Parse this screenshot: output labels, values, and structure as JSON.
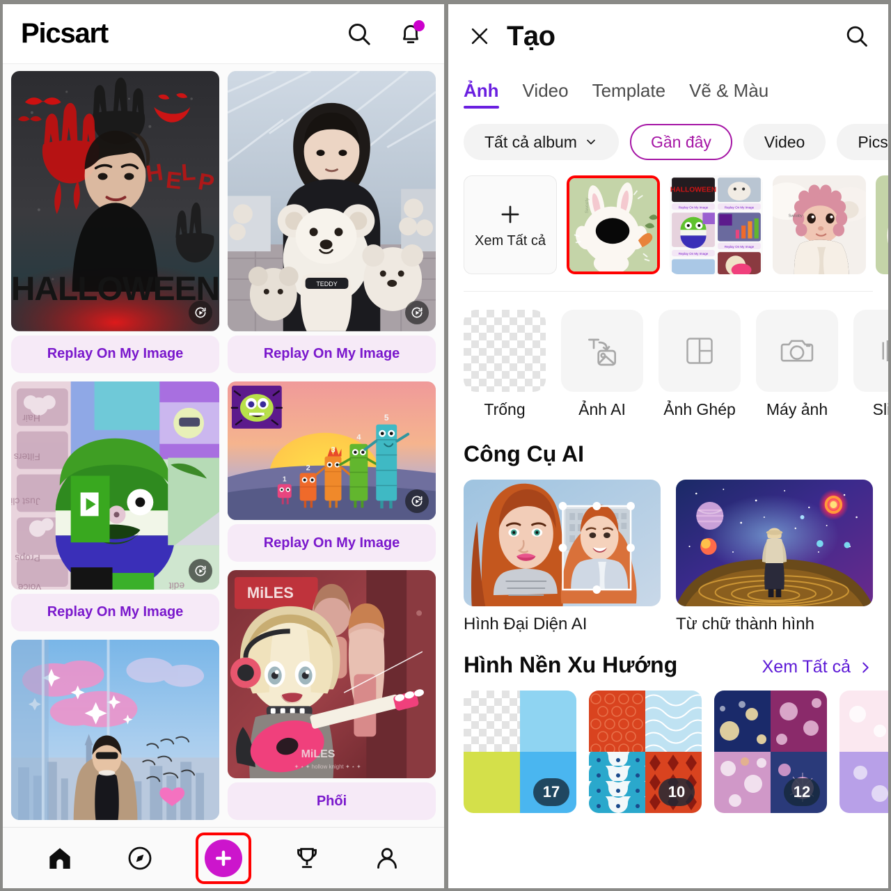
{
  "left": {
    "header": {
      "logo": "Picsart",
      "search_icon": "search-icon",
      "bell_icon": "bell-icon"
    },
    "feed": {
      "cards": [
        {
          "id": "halloween",
          "cta": "Replay On My Image",
          "has_replay_badge": true,
          "column": "left"
        },
        {
          "id": "teddy-bear",
          "cta": "Replay On My Image",
          "has_replay_badge": true,
          "column": "right"
        },
        {
          "id": "green-avatar",
          "cta": "Replay On My Image",
          "has_replay_badge": true,
          "column": "left"
        },
        {
          "id": "numberblocks",
          "cta": "Replay On My Image",
          "has_replay_badge": true,
          "column": "right"
        },
        {
          "id": "city-clouds",
          "cta": "",
          "has_replay_badge": false,
          "column": "left"
        },
        {
          "id": "guitar-girl",
          "cta": "Phối",
          "has_replay_badge": false,
          "column": "right"
        }
      ]
    },
    "nav": {
      "items": [
        {
          "name": "home",
          "icon": "home-icon",
          "active": true
        },
        {
          "name": "explore",
          "icon": "compass-icon",
          "active": false
        },
        {
          "name": "create",
          "icon": "plus-icon",
          "active": false,
          "highlighted": true
        },
        {
          "name": "challenges",
          "icon": "trophy-icon",
          "active": false
        },
        {
          "name": "profile",
          "icon": "person-icon",
          "active": false
        }
      ]
    }
  },
  "right": {
    "header": {
      "close_icon": "close-icon",
      "title": "Tạo",
      "search_icon": "search-icon"
    },
    "tabs": [
      {
        "label": "Ảnh",
        "active": true
      },
      {
        "label": "Video",
        "active": false
      },
      {
        "label": "Template",
        "active": false
      },
      {
        "label": "Vẽ & Màu",
        "active": false
      }
    ],
    "chips": [
      {
        "label": "Tất cả album",
        "has_chevron": true,
        "selected": false
      },
      {
        "label": "Gần đây",
        "has_chevron": false,
        "selected": true
      },
      {
        "label": "Video",
        "has_chevron": false,
        "selected": false
      },
      {
        "label": "Picsart",
        "has_chevron": false,
        "selected": false
      }
    ],
    "recent": {
      "add_label": "Xem Tất cả",
      "add_icon": "plus-icon",
      "tiles": [
        {
          "id": "bunny",
          "selected": true
        },
        {
          "id": "app-screenshot",
          "selected": false
        },
        {
          "id": "baby",
          "selected": false
        },
        {
          "id": "bunny-2",
          "selected": false
        }
      ]
    },
    "tools": [
      {
        "label": "Trống",
        "icon": "transparent-checkerboard-icon"
      },
      {
        "label": "Ảnh AI",
        "icon": "text-to-image-icon"
      },
      {
        "label": "Ảnh Ghép",
        "icon": "collage-icon"
      },
      {
        "label": "Máy ảnh",
        "icon": "camera-icon"
      },
      {
        "label": "Slides",
        "icon": "slides-icon"
      }
    ],
    "ai_tools": {
      "title": "Công Cụ AI",
      "cards": [
        {
          "label": "Hình Đại Diện AI",
          "id": "ai-avatar"
        },
        {
          "label": "Từ chữ thành hình",
          "id": "text-to-image"
        }
      ]
    },
    "backgrounds": {
      "title": "Hình Nền Xu Hướng",
      "see_all": "Xem Tất cả",
      "chevron_icon": "chevron-right-icon",
      "tiles": [
        {
          "id": "solid-colors",
          "count": "17"
        },
        {
          "id": "patterns",
          "count": "10"
        },
        {
          "id": "bokeh",
          "count": "12"
        },
        {
          "id": "pastel",
          "count": ""
        }
      ]
    }
  },
  "colors": {
    "accent_purple": "#6a1fe0",
    "accent_magenta": "#cc15cc",
    "chip_selected": "#a515a5",
    "cta_bg": "#f6eaf7",
    "cta_text": "#7a18cc",
    "highlight_box": "#ff0000"
  }
}
